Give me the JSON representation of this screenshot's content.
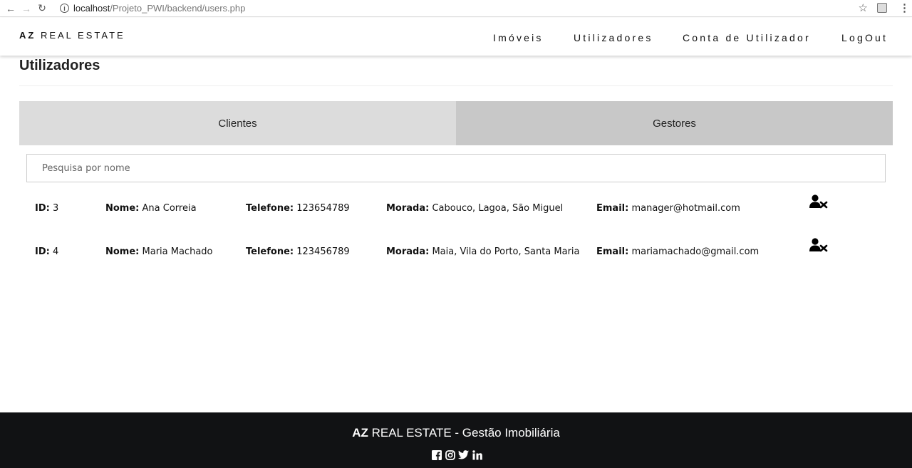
{
  "browser": {
    "url_host": "localhost",
    "url_path": "/Projeto_PWI/backend/users.php"
  },
  "header": {
    "brand_bold": "AZ",
    "brand_rest": " REAL ESTATE",
    "nav": [
      "Imóveis",
      "Utilizadores",
      "Conta de Utilizador",
      "LogOut"
    ]
  },
  "main": {
    "title": "Utilizadores",
    "tabs": [
      "Clientes",
      "Gestores"
    ],
    "search_placeholder": "Pesquisa por nome",
    "field_labels": {
      "id": "ID:",
      "nome": "Nome:",
      "telefone": "Telefone:",
      "morada": "Morada:",
      "email": "Email:"
    },
    "users": [
      {
        "id": "3",
        "nome": "Ana Correia",
        "telefone": "123654789",
        "morada": "Cabouco, Lagoa, São Miguel",
        "email": "manager@hotmail.com"
      },
      {
        "id": "4",
        "nome": "Maria Machado",
        "telefone": "123456789",
        "morada": "Maia, Vila do Porto, Santa Maria",
        "email": "mariamachado@gmail.com"
      }
    ],
    "row_action_icon": "user-times-icon"
  },
  "footer": {
    "brand_bold": "AZ",
    "brand_rest": " REAL ESTATE - Gestão Imobiliária",
    "social_icons": [
      "facebook-icon",
      "instagram-icon",
      "twitter-icon",
      "linkedin-icon"
    ]
  }
}
